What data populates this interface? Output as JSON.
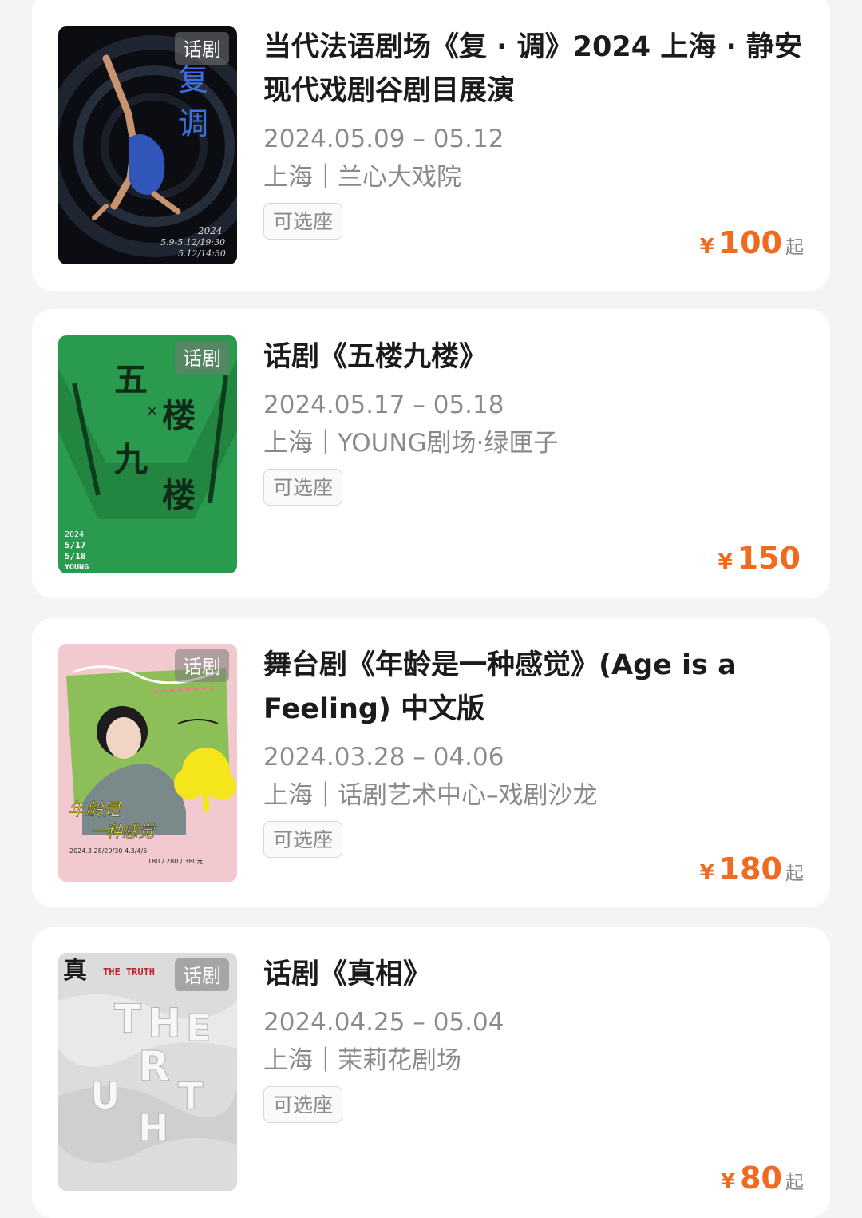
{
  "shows": [
    {
      "tag": "话剧",
      "title": "当代法语剧场《复 · 调》2024 上海 · 静安现代戏剧谷剧目展演",
      "dates": "2024.05.09 – 05.12",
      "venue": "上海｜兰心大戏院",
      "seat_label": "可选座",
      "price_currency": "¥",
      "price": "100",
      "price_suffix": "起",
      "poster_text": [
        "复",
        "调",
        "2024",
        "5.9-5.12/19:30",
        "5.12/14:30"
      ]
    },
    {
      "tag": "话剧",
      "title": "话剧《五楼九楼》",
      "dates": "2024.05.17 – 05.18",
      "venue": "上海｜YOUNG剧场·绿匣子",
      "seat_label": "可选座",
      "price_currency": "¥",
      "price": "150",
      "price_suffix": "",
      "poster_text": [
        "五",
        "楼",
        "九",
        "楼",
        "2024",
        "5/17",
        "5/18",
        "YOUNG"
      ]
    },
    {
      "tag": "话剧",
      "title": "舞台剧《年龄是一种感觉》(Age is a Feeling) 中文版",
      "dates": "2024.03.28 – 04.06",
      "venue": "上海｜话剧艺术中心–戏剧沙龙",
      "seat_label": "可选座",
      "price_currency": "¥",
      "price": "180",
      "price_suffix": "起",
      "poster_text": [
        "年龄是",
        "一种感觉",
        "2024.3.28/29/30 4.3/4/5",
        "180 / 280 / 380元"
      ]
    },
    {
      "tag": "话剧",
      "title": "话剧《真相》",
      "dates": "2024.04.25 – 05.04",
      "venue": "上海｜茉莉花剧场",
      "seat_label": "可选座",
      "price_currency": "¥",
      "price": "80",
      "price_suffix": "起",
      "poster_text": [
        "真",
        "THE TRUTH",
        "T",
        "H",
        "E",
        "R",
        "U",
        "T",
        "H"
      ]
    }
  ]
}
